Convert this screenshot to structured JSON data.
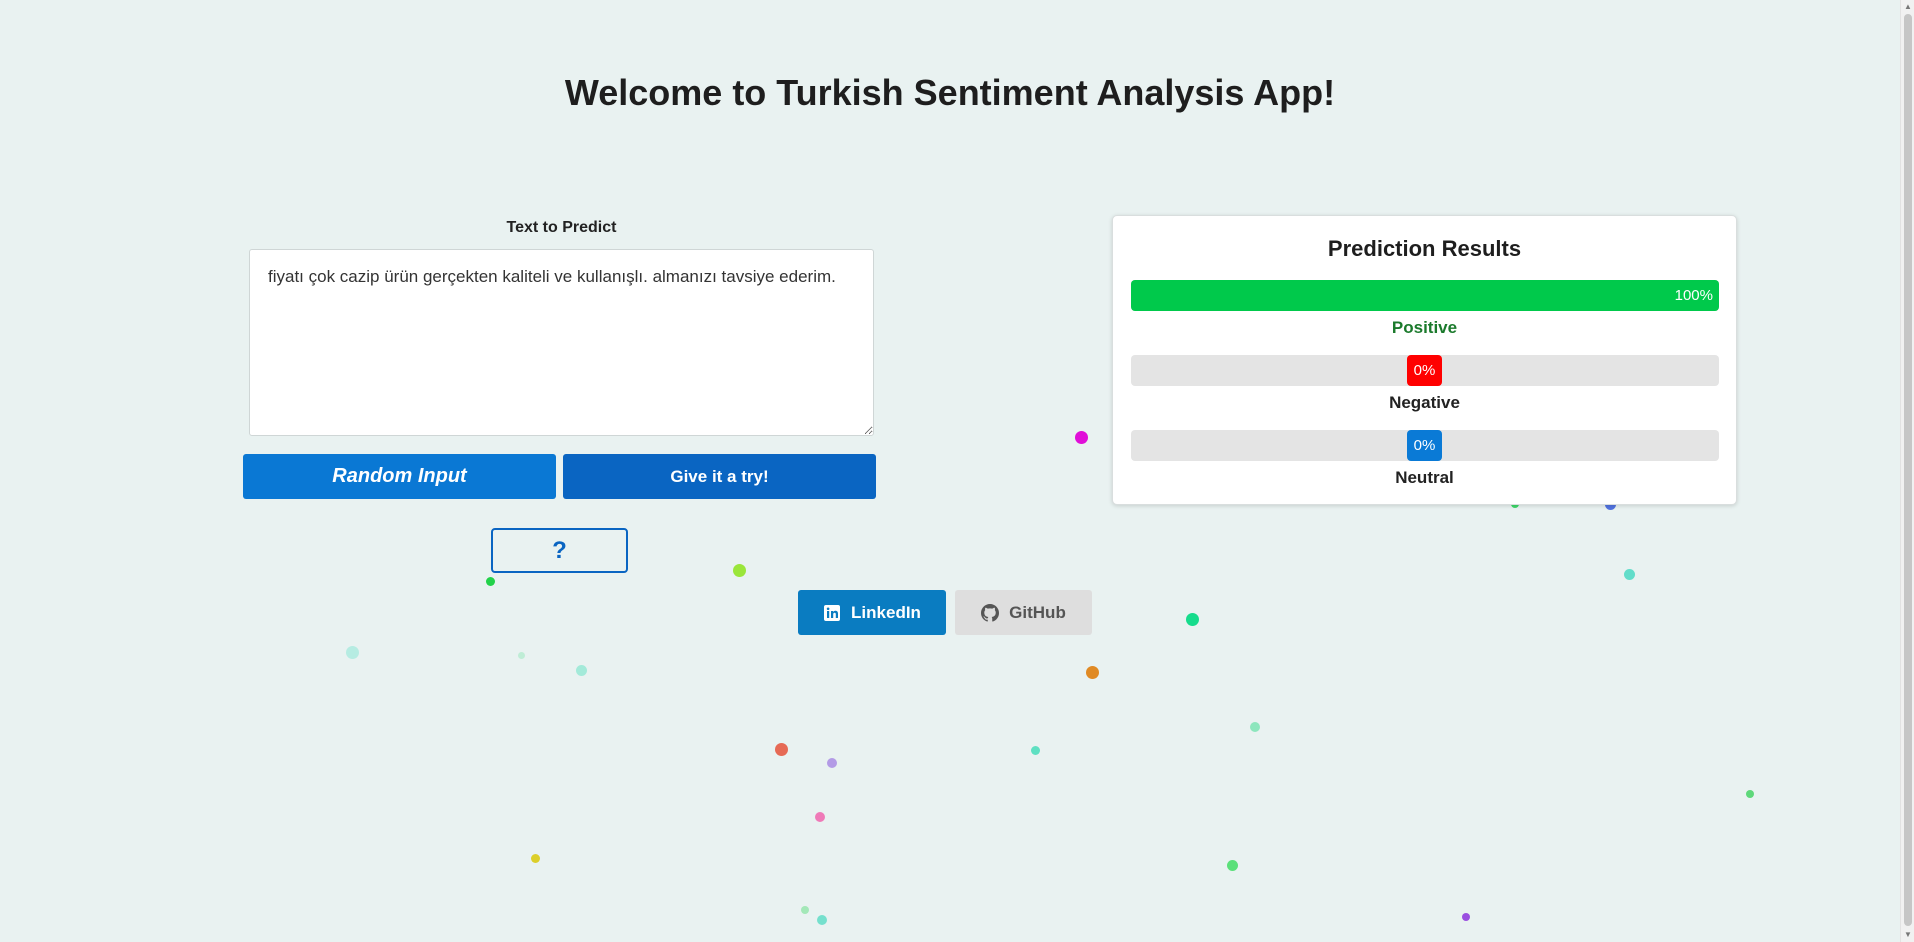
{
  "page": {
    "title": "Welcome to Turkish Sentiment Analysis App!"
  },
  "input": {
    "label": "Text to Predict",
    "value": "fiyatı çok cazip ürün gerçekten kaliteli ve kullanışlı. almanızı tavsiye ederim."
  },
  "buttons": {
    "random": "Random Input",
    "try": "Give it a try!",
    "help": "?"
  },
  "results": {
    "title": "Prediction Results",
    "items": [
      {
        "label": "Positive",
        "percent_text": "100%",
        "value": 1.0,
        "color": "#00c94b",
        "label_color": "#1b7a2c"
      },
      {
        "label": "Negative",
        "percent_text": "0%",
        "value": 0.0,
        "color": "#ff0000",
        "label_color": "#222222"
      },
      {
        "label": "Neutral",
        "percent_text": "0%",
        "value": 0.0,
        "color": "#0a7ad6",
        "label_color": "#222222"
      }
    ]
  },
  "social": {
    "linkedin": {
      "label": "LinkedIn",
      "icon": "linkedin-icon"
    },
    "github": {
      "label": "GitHub",
      "icon": "github-icon"
    }
  },
  "colors": {
    "background": "#e9f2f1",
    "primary": "#0a65c2",
    "accent": "#0a78d4"
  }
}
